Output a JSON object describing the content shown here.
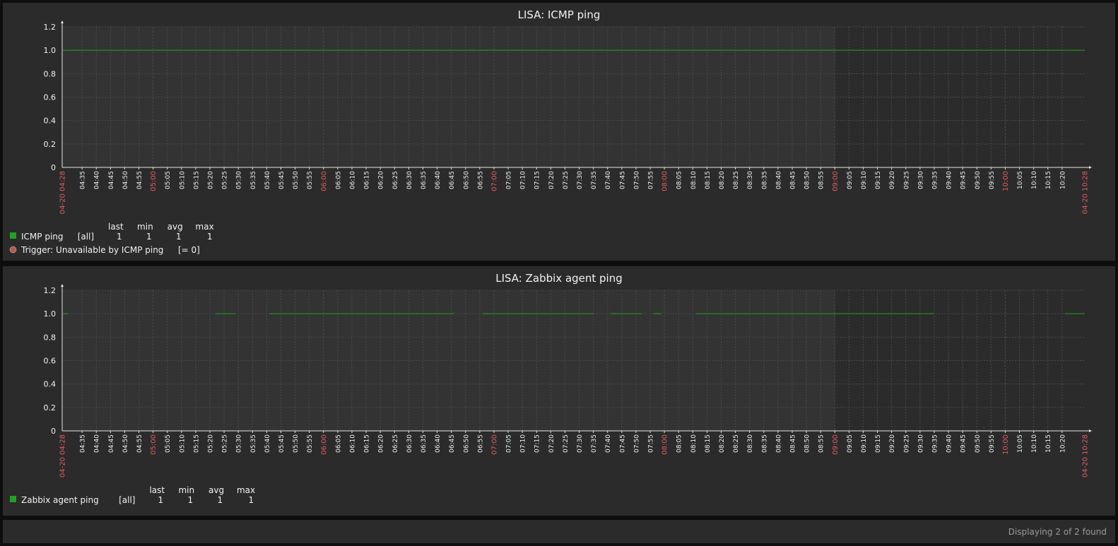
{
  "colors": {
    "background": "#2b2b2b",
    "plot_bg": "#333333",
    "plot_bg_right": "#2b2b2b",
    "grid": "#4a4a4a",
    "axis": "#e6e6e6",
    "text": "#f2f2f2",
    "hour_label": "#e05c5c",
    "series_green": "#1fa31f",
    "trigger_marker": "#b85a4a"
  },
  "time_axis": {
    "start": "04:28",
    "end": "10:28",
    "start_label": "04-20 04:28",
    "end_label": "04-20 10:28",
    "shade_end": "09:00",
    "minor_ticks": [
      "04:35",
      "04:40",
      "04:45",
      "04:50",
      "04:55",
      "05:00",
      "05:05",
      "05:10",
      "05:15",
      "05:20",
      "05:25",
      "05:30",
      "05:35",
      "05:40",
      "05:45",
      "05:50",
      "05:55",
      "06:00",
      "06:05",
      "06:10",
      "06:15",
      "06:20",
      "06:25",
      "06:30",
      "06:35",
      "06:40",
      "06:45",
      "06:50",
      "06:55",
      "07:00",
      "07:05",
      "07:10",
      "07:15",
      "07:20",
      "07:25",
      "07:30",
      "07:35",
      "07:40",
      "07:45",
      "07:50",
      "07:55",
      "08:00",
      "08:05",
      "08:10",
      "08:15",
      "08:20",
      "08:25",
      "08:30",
      "08:35",
      "08:40",
      "08:45",
      "08:50",
      "08:55",
      "09:00",
      "09:05",
      "09:10",
      "09:15",
      "09:20",
      "09:25",
      "09:30",
      "09:35",
      "09:40",
      "09:45",
      "09:50",
      "09:55",
      "10:00",
      "10:05",
      "10:10",
      "10:15",
      "10:20"
    ],
    "hour_ticks": [
      "05:00",
      "06:00",
      "07:00",
      "08:00",
      "09:00",
      "10:00"
    ]
  },
  "chart_data": [
    {
      "type": "line",
      "title": "LISA: ICMP ping",
      "ylim": [
        0,
        1.2
      ],
      "yticks": [
        "0",
        "0.2",
        "0.4",
        "0.6",
        "0.8",
        "1.0",
        "1.2"
      ],
      "grid": true,
      "series": [
        {
          "name": "ICMP ping",
          "color": "#1fa31f",
          "segments": [
            [
              "04:28",
              "10:28",
              1
            ]
          ]
        }
      ],
      "legend": {
        "headers": [
          "last",
          "min",
          "avg",
          "max"
        ],
        "rows": [
          {
            "name": "ICMP ping",
            "scope": "[all]",
            "last": "1",
            "min": "1",
            "avg": "1",
            "max": "1"
          }
        ],
        "trigger": {
          "label": "Trigger: Unavailable by ICMP ping",
          "condition": "[= 0]"
        }
      }
    },
    {
      "type": "line",
      "title": "LISA: Zabbix agent ping",
      "ylim": [
        0,
        1.2
      ],
      "yticks": [
        "0",
        "0.2",
        "0.4",
        "0.6",
        "0.8",
        "1.0",
        "1.2"
      ],
      "grid": true,
      "series": [
        {
          "name": "Zabbix agent ping",
          "color": "#1fa31f",
          "segments": [
            [
              "04:28",
              "04:30",
              1
            ],
            [
              "05:22",
              "05:29",
              1
            ],
            [
              "05:41",
              "06:46",
              1
            ],
            [
              "06:56",
              "07:35",
              1
            ],
            [
              "07:41",
              "07:52",
              1
            ],
            [
              "07:56",
              "07:59",
              1
            ],
            [
              "08:11",
              "09:35",
              1
            ],
            [
              "10:21",
              "10:28",
              1
            ]
          ]
        }
      ],
      "legend": {
        "headers": [
          "last",
          "min",
          "avg",
          "max"
        ],
        "rows": [
          {
            "name": "Zabbix agent ping",
            "scope": "[all]",
            "last": "1",
            "min": "1",
            "avg": "1",
            "max": "1"
          }
        ]
      }
    }
  ],
  "footer": {
    "status": "Displaying 2 of 2 found"
  }
}
